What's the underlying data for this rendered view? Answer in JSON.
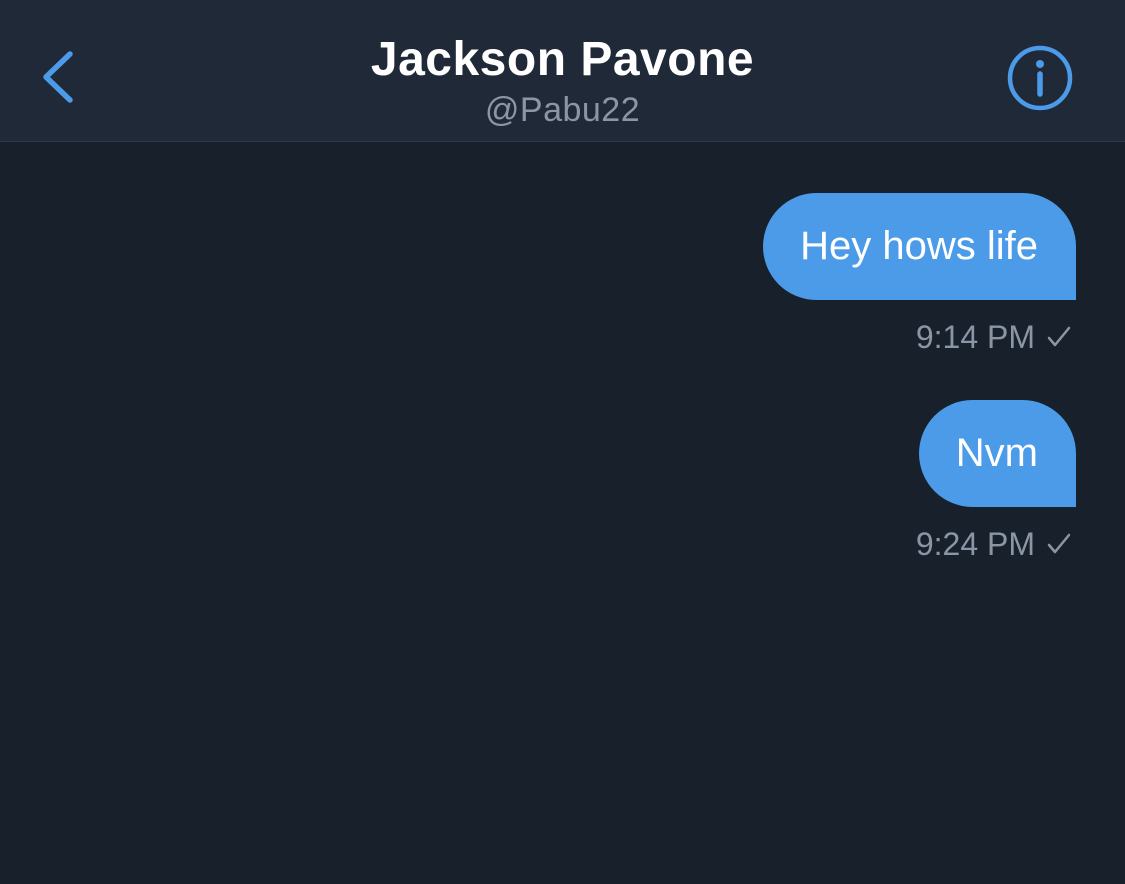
{
  "header": {
    "title": "Jackson Pavone",
    "handle": "@Pabu22",
    "back_icon": "chevron-left-icon",
    "info_icon": "info-circle-icon"
  },
  "messages": [
    {
      "text": "Hey hows life",
      "time": "9:14 PM",
      "status_icon": "sent-check-icon"
    },
    {
      "text": "Nvm",
      "time": "9:24 PM",
      "status_icon": "sent-check-icon"
    }
  ],
  "colors": {
    "background": "#18202b",
    "header_background": "#1f2938",
    "accent": "#4b9be9",
    "muted_text": "#8a96a6",
    "title_text": "#ffffff"
  }
}
